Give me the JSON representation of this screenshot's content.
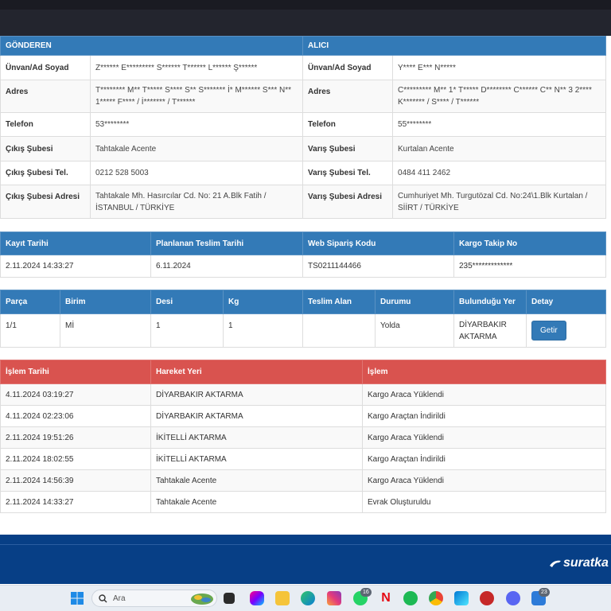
{
  "party": {
    "sender_header": "GÖNDEREN",
    "receiver_header": "ALICI",
    "rows": [
      {
        "l1": "Ünvan/Ad Soyad",
        "v1": "Z****** E********* S****** T****** L****** Ş******",
        "l2": "Ünvan/Ad Soyad",
        "v2": "Y**** E*** N*****"
      },
      {
        "l1": "Adres",
        "v1": "T******** M** T***** S**** S** S******* İ* M****** S*** N** 1***** F**** / İ******* / T******",
        "l2": "Adres",
        "v2": "C********* M** 1* T***** D******** C****** C** N** 3 2**** K******* / S**** / T******"
      },
      {
        "l1": "Telefon",
        "v1": "53********",
        "l2": "Telefon",
        "v2": "55********"
      },
      {
        "l1": "Çıkış Şubesi",
        "v1": "Tahtakale Acente",
        "l2": "Varış Şubesi",
        "v2": "Kurtalan Acente"
      },
      {
        "l1": "Çıkış Şubesi Tel.",
        "v1": "0212 528 5003",
        "l2": "Varış Şubesi Tel.",
        "v2": "0484 411 2462"
      },
      {
        "l1": "Çıkış Şubesi Adresi",
        "v1": "Tahtakale Mh. Hasırcılar Cd. No: 21 A.Blk Fatih / İSTANBUL / TÜRKİYE",
        "l2": "Varış Şubesi Adresi",
        "v2": "Cumhuriyet Mh. Turgutözal Cd. No:24\\1.Blk Kurtalan / SİİRT / TÜRKİYE"
      }
    ]
  },
  "order": {
    "headers": [
      "Kayıt Tarihi",
      "Planlanan Teslim Tarihi",
      "Web Sipariş Kodu",
      "Kargo Takip No"
    ],
    "values": [
      "2.11.2024 14:33:27",
      "6.11.2024",
      "TS0211144466",
      "235*************"
    ]
  },
  "piece": {
    "headers": [
      "Parça",
      "Birim",
      "Desi",
      "Kg",
      "Teslim Alan",
      "Durumu",
      "Bulunduğu Yer",
      "Detay"
    ],
    "values": [
      "1/1",
      "Mİ",
      "1",
      "1",
      "",
      "Yolda",
      "DİYARBAKIR AKTARMA"
    ],
    "button_label": "Getir"
  },
  "history": {
    "headers": [
      "İşlem Tarihi",
      "Hareket Yeri",
      "İşlem"
    ],
    "rows": [
      [
        "4.11.2024 03:19:27",
        "DİYARBAKIR AKTARMA",
        "Kargo Araca Yüklendi"
      ],
      [
        "4.11.2024 02:23:06",
        "DİYARBAKIR AKTARMA",
        "Kargo Araçtan İndirildi"
      ],
      [
        "2.11.2024 19:51:26",
        "İKİTELLİ AKTARMA",
        "Kargo Araca Yüklendi"
      ],
      [
        "2.11.2024 18:02:55",
        "İKİTELLİ AKTARMA",
        "Kargo Araçtan İndirildi"
      ],
      [
        "2.11.2024 14:56:39",
        "Tahtakale Acente",
        "Kargo Araca Yüklendi"
      ],
      [
        "2.11.2024 14:33:27",
        "Tahtakale Acente",
        "Evrak Oluşturuldu"
      ]
    ]
  },
  "footer": {
    "logo_text": "suratka"
  },
  "taskbar": {
    "search_placeholder": "Ara",
    "whatsapp_badge": "16",
    "notify_badge": "23"
  },
  "colors": {
    "blue_header": "#337ab7",
    "red_header": "#d9534f",
    "footer": "#073f86"
  }
}
